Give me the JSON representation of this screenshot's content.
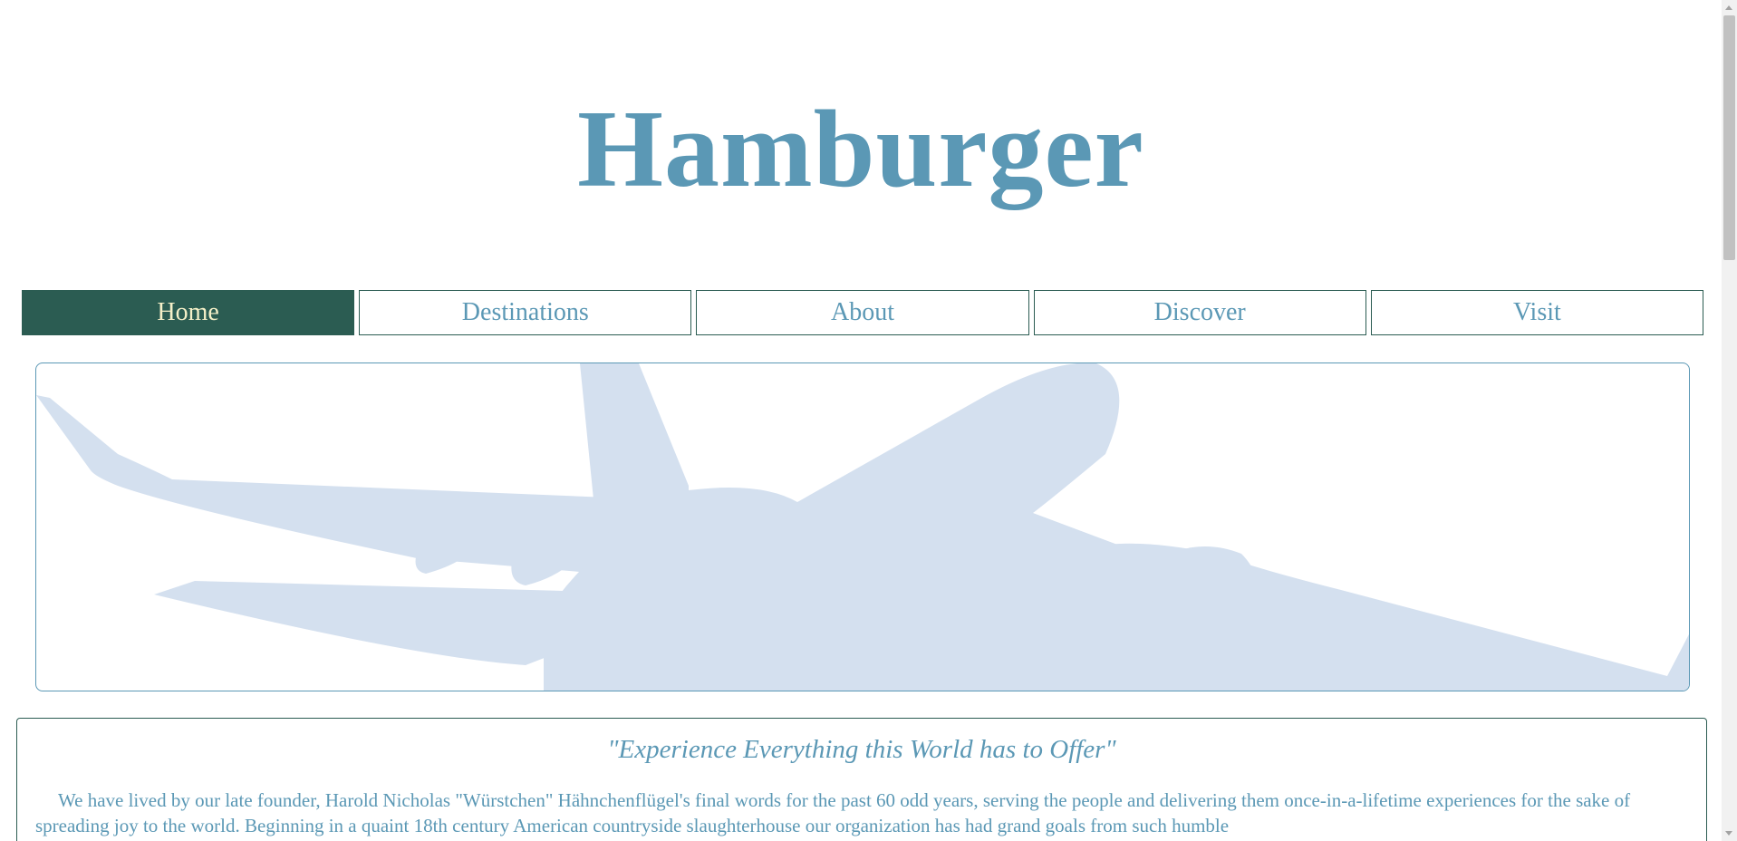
{
  "site": {
    "title": "Hamburger"
  },
  "nav": {
    "items": [
      {
        "label": "Home",
        "active": true
      },
      {
        "label": "Destinations",
        "active": false
      },
      {
        "label": "About",
        "active": false
      },
      {
        "label": "Discover",
        "active": false
      },
      {
        "label": "Visit",
        "active": false
      }
    ]
  },
  "hero": {
    "image": "airplane-silhouette"
  },
  "content": {
    "tagline": "\"Experience Everything this World has to Offer\"",
    "paragraph": "We have lived by our late founder, Harold Nicholas \"Würstchen\" Hähnchenflügel's final words for the past 60 odd years, serving the people and delivering them once-in-a-lifetime experiences for the sake of spreading joy to the world. Beginning in a quaint 18th century American countryside slaughterhouse our organization has had grand goals from such humble"
  },
  "colors": {
    "accent": "#5b98b5",
    "nav_active_bg": "#2b5c52",
    "nav_active_text": "#f5f0c8",
    "nav_border": "#2b5c52",
    "silhouette": "#d4e0ef"
  }
}
